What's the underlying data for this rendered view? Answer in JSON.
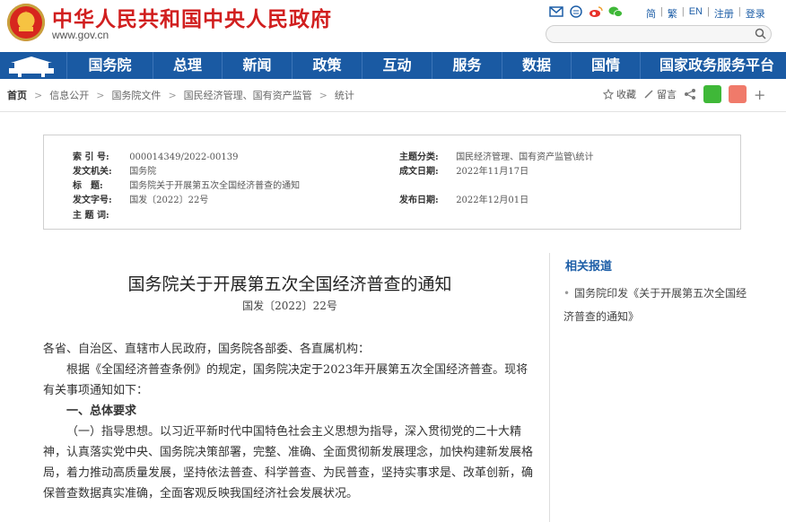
{
  "header": {
    "site_title": "中华人民共和国中央人民政府",
    "site_url": "www.gov.cn",
    "links": [
      "简",
      "繁",
      "EN",
      "注册",
      "登录"
    ]
  },
  "nav": {
    "items": [
      "国务院",
      "总理",
      "新闻",
      "政策",
      "互动",
      "服务",
      "数据",
      "国情",
      "国家政务服务平台"
    ]
  },
  "breadcrumb": [
    "首页",
    "信息公开",
    "国务院文件",
    "国民经济管理、国有资产监管",
    "统计"
  ],
  "tools": {
    "favorite": "收藏",
    "comment": "留言"
  },
  "info": {
    "index_label": "索 引 号:",
    "index_value": "000014349/2022-00139",
    "category_label": "主题分类:",
    "category_value": "国民经济管理、国有资产监管\\统计",
    "issuer_label": "发文机关:",
    "issuer_value": "国务院",
    "date_written_label": "成文日期:",
    "date_written_value": "2022年11月17日",
    "title_label": "标　题:",
    "title_value": "国务院关于开展第五次全国经济普查的通知",
    "doc_no_label": "发文字号:",
    "doc_no_value": "国发〔2022〕22号",
    "publish_label": "发布日期:",
    "publish_value": "2022年12月01日",
    "keywords_label": "主 题 词:"
  },
  "article": {
    "title": "国务院关于开展第五次全国经济普查的通知",
    "doc_no": "国发〔2022〕22号",
    "salutation": "各省、自治区、直辖市人民政府，国务院各部委、各直属机构：",
    "para1": "根据《全国经济普查条例》的规定，国务院决定于2023年开展第五次全国经济普查。现将有关事项通知如下：",
    "section1": "一、总体要求",
    "para2": "（一）指导思想。以习近平新时代中国特色社会主义思想为指导，深入贯彻党的二十大精神，认真落实党中央、国务院决策部署，完整、准确、全面贯彻新发展理念，加快构建新发展格局，着力推动高质量发展，坚持依法普查、科学普查、为民普查，坚持实事求是、改革创新，确保普查数据真实准确，全面客观反映我国经济社会发展状况。"
  },
  "sidebar": {
    "title": "相关报道",
    "items": [
      "国务院印发《关于开展第五次全国经济普查的通知》"
    ]
  }
}
